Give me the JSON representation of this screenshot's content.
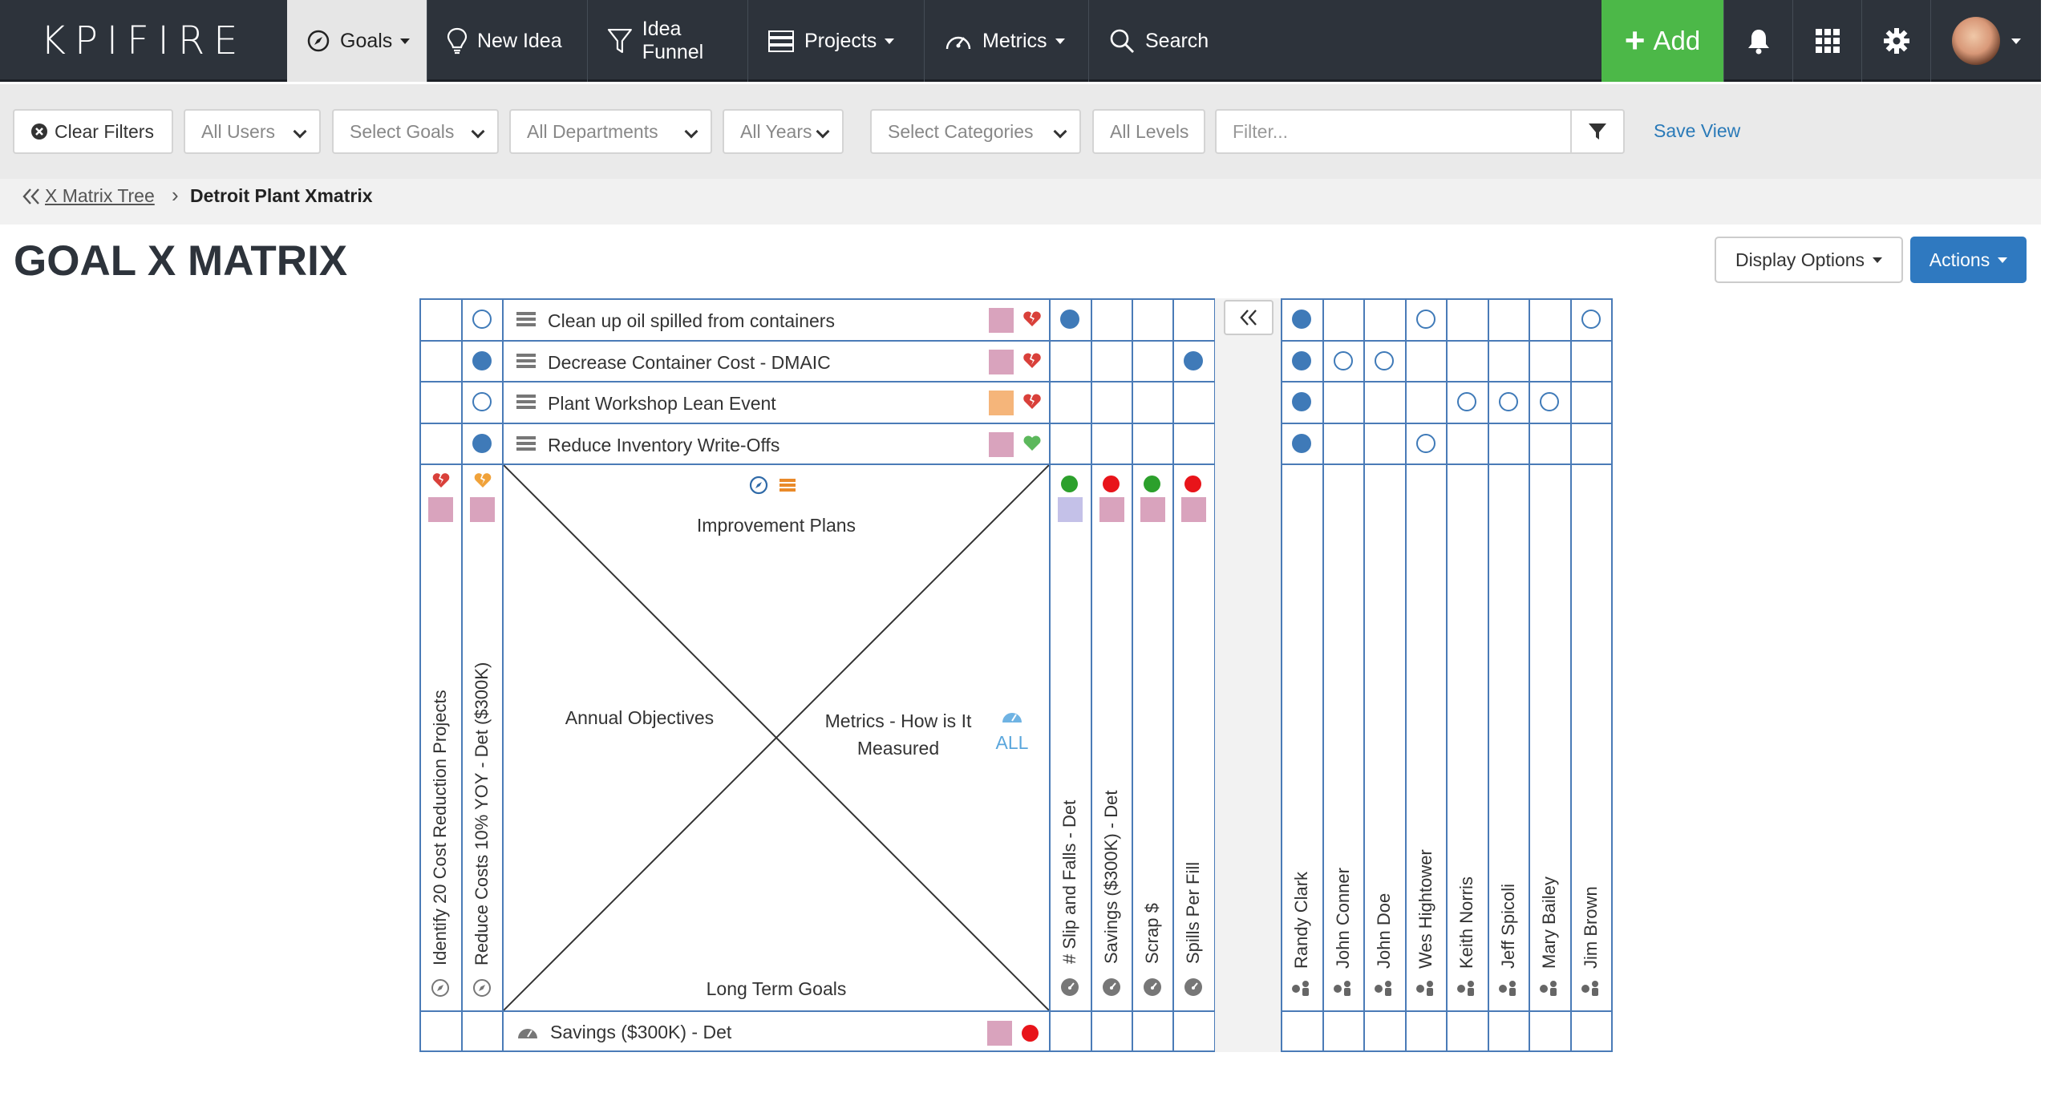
{
  "nav": {
    "logo": "KPIFIRE",
    "goals": "Goals",
    "new_idea": "New Idea",
    "idea_funnel": "Idea Funnel",
    "projects": "Projects",
    "metrics": "Metrics",
    "search": "Search",
    "add": "Add"
  },
  "filters": {
    "clear": "Clear Filters",
    "users": "All Users",
    "goals": "Select Goals",
    "departments": "All Departments",
    "years": "All Years",
    "categories": "Select Categories",
    "levels": "All Levels",
    "filter_placeholder": "Filter...",
    "save_view": "Save View"
  },
  "breadcrumb": {
    "parent": "X Matrix Tree",
    "current": "Detroit Plant Xmatrix"
  },
  "page": {
    "title": "GOAL X MATRIX",
    "display_options": "Display Options",
    "actions": "Actions"
  },
  "matrix": {
    "improvement_plans": [
      {
        "name": "Clean up oil spilled from containers",
        "color": "#d9a3bd",
        "health": "broken-heart"
      },
      {
        "name": "Decrease Container Cost - DMAIC",
        "color": "#d9a3bd",
        "health": "broken-heart"
      },
      {
        "name": "Plant Workshop Lean Event",
        "color": "#f5b57a",
        "health": "broken-heart"
      },
      {
        "name": "Reduce Inventory Write-Offs",
        "color": "#d9a3bd",
        "health": "heart"
      }
    ],
    "annual_objectives": [
      {
        "name": "Identify 20 Cost Reduction Projects",
        "color": "#d9a3bd"
      },
      {
        "name": "Reduce Costs 10% YOY - Det ($300K)",
        "color": "#d9a3bd"
      }
    ],
    "metrics": [
      {
        "name": "# Slip and Falls - Det",
        "color": "#c4c1e8",
        "status": "#2ca02c"
      },
      {
        "name": "Savings ($300K) - Det",
        "color": "#d9a3bd",
        "status": "#e8141a"
      },
      {
        "name": "Scrap $",
        "color": "#d9a3bd",
        "status": "#2ca02c"
      },
      {
        "name": "Spills Per Fill",
        "color": "#d9a3bd",
        "status": "#e8141a"
      }
    ],
    "people": [
      "Randy Clark",
      "John Conner",
      "John Doe",
      "Wes Hightower",
      "Keith Norris",
      "Jeff Spicoli",
      "Mary Bailey",
      "Jim Brown"
    ],
    "long_term_goal": {
      "name": "Savings ($300K) - Det",
      "color": "#d9a3bd",
      "status": "#e8141a"
    },
    "labels": {
      "top": "Improvement Plans",
      "left": "Annual Objectives",
      "right": "Metrics - How is It Measured",
      "bottom": "Long Term Goals",
      "all": "ALL"
    },
    "plan_objective_links": [
      "open",
      "filled",
      "open",
      "filled"
    ],
    "plan_metric_links": [
      [
        "filled",
        "",
        "",
        ""
      ],
      [
        "",
        "",
        "",
        "filled"
      ],
      [
        "",
        "",
        "",
        ""
      ],
      [
        "",
        "",
        "",
        ""
      ]
    ],
    "plan_people_links": [
      [
        "filled",
        "",
        "",
        "open",
        "",
        "",
        "",
        "open"
      ],
      [
        "filled",
        "open",
        "open",
        "",
        "",
        "",
        "",
        ""
      ],
      [
        "filled",
        "",
        "",
        "",
        "open",
        "open",
        "open",
        ""
      ],
      [
        "filled",
        "",
        "",
        "open",
        "",
        "",
        "",
        ""
      ]
    ]
  }
}
